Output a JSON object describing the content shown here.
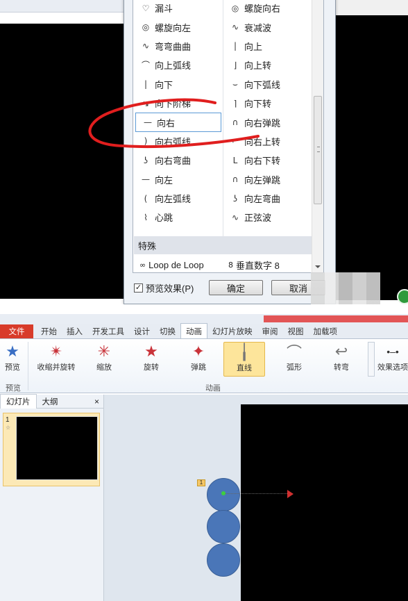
{
  "dialog": {
    "left_items": [
      {
        "icon": "funnel-icon",
        "glyph": "♡",
        "label": "漏斗"
      },
      {
        "icon": "spiral-left-icon",
        "glyph": "◎",
        "label": "螺旋向左"
      },
      {
        "icon": "curvy-curve-icon",
        "glyph": "∿",
        "label": "弯弯曲曲"
      },
      {
        "icon": "arc-up-icon",
        "glyph": "⌒",
        "label": "向上弧线"
      },
      {
        "icon": "down-line-icon",
        "glyph": "|",
        "label": "向下"
      },
      {
        "icon": "down-steps-icon",
        "glyph": "↘",
        "label": "向下阶梯"
      },
      {
        "icon": "right-line-icon",
        "glyph": "—",
        "label": "向右"
      },
      {
        "icon": "arc-right-icon",
        "glyph": ")",
        "label": "向右弧线"
      },
      {
        "icon": "curve-right-icon",
        "glyph": "ʖ",
        "label": "向右弯曲"
      },
      {
        "icon": "left-line-icon",
        "glyph": "—",
        "label": "向左"
      },
      {
        "icon": "arc-left-icon",
        "glyph": "(",
        "label": "向左弧线"
      },
      {
        "icon": "heartbeat-icon",
        "glyph": "⌇",
        "label": "心跳"
      }
    ],
    "right_items": [
      {
        "icon": "spiral-right-icon",
        "glyph": "◎",
        "label": "螺旋向右"
      },
      {
        "icon": "decaying-wave-icon",
        "glyph": "∿",
        "label": "衰减波"
      },
      {
        "icon": "up-line-icon",
        "glyph": "|",
        "label": "向上"
      },
      {
        "icon": "turn-up-icon",
        "glyph": "⌋",
        "label": "向上转"
      },
      {
        "icon": "arc-down-icon",
        "glyph": "⌣",
        "label": "向下弧线"
      },
      {
        "icon": "turn-down-icon",
        "glyph": "⌉",
        "label": "向下转"
      },
      {
        "icon": "bounce-right-icon",
        "glyph": "∩",
        "label": "向右弹跳"
      },
      {
        "icon": "turn-right-up-icon",
        "glyph": "⌐",
        "label": "向右上转"
      },
      {
        "icon": "turn-right-down-icon",
        "glyph": "L",
        "label": "向右下转"
      },
      {
        "icon": "bounce-left-icon",
        "glyph": "∩",
        "label": "向左弹跳"
      },
      {
        "icon": "curve-left-icon",
        "glyph": "ʖ",
        "label": "向左弯曲"
      },
      {
        "icon": "sine-wave-icon",
        "glyph": "∿",
        "label": "正弦波"
      }
    ],
    "section_label": "特殊",
    "special_left": {
      "icon": "loop-icon",
      "glyph": "∞",
      "label": "Loop de Loop"
    },
    "special_right": {
      "icon": "vertical-eight-icon",
      "glyph": "8",
      "label": "垂直数字 8"
    },
    "preview_label": "预览效果(P)",
    "preview_checked": true,
    "ok_label": "确定",
    "cancel_label": "取消"
  },
  "ribbon": {
    "tabs": [
      "文件",
      "开始",
      "插入",
      "开发工具",
      "设计",
      "切换",
      "动画",
      "幻灯片放映",
      "审阅",
      "视图",
      "加载项"
    ],
    "active_tab": "动画",
    "preview_label": "预览",
    "preview_group_label": "预览",
    "animation_group_label": "动画",
    "effect_options_label": "效果选项",
    "buttons": [
      {
        "name": "shrink-spin",
        "glyph": "✴",
        "label": "收缩并旋转"
      },
      {
        "name": "zoom",
        "glyph": "✳",
        "label": "缩放"
      },
      {
        "name": "spin",
        "glyph": "★",
        "label": "旋转"
      },
      {
        "name": "bounce",
        "glyph": "✦",
        "label": "弹跳"
      },
      {
        "name": "lines",
        "glyph": "╽",
        "label": "直线"
      },
      {
        "name": "arcs",
        "glyph": "⌒",
        "label": "弧形"
      },
      {
        "name": "turns",
        "glyph": "↩",
        "label": "转弯"
      }
    ],
    "selected_button": "直线"
  },
  "slides_panel": {
    "tab_slides": "幻灯片",
    "tab_outline": "大纲",
    "close": "×",
    "slide_number": "1"
  },
  "canvas": {
    "badge": "1"
  },
  "colors": {
    "file_tab": "#d83b2a",
    "selection": "#fde59b",
    "circle_fill": "#4a76b8",
    "annotation_red": "#e01e1e"
  }
}
